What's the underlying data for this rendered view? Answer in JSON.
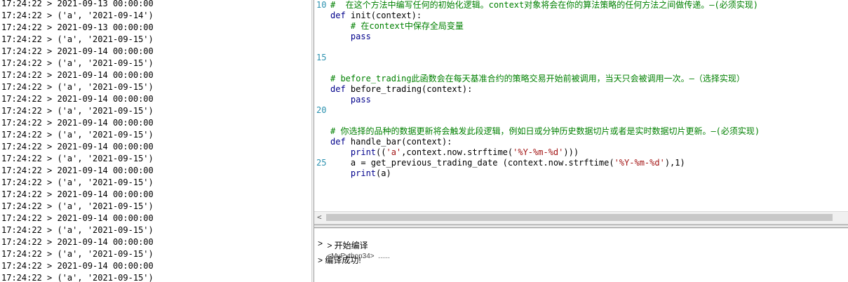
{
  "log": {
    "lines": [
      "17:24:22 > 2021-09-13 00:00:00",
      "17:24:22 > ('a', '2021-09-14')",
      "17:24:22 > 2021-09-13 00:00:00",
      "17:24:22 > ('a', '2021-09-15')",
      "17:24:22 > 2021-09-14 00:00:00",
      "17:24:22 > ('a', '2021-09-15')",
      "17:24:22 > 2021-09-14 00:00:00",
      "17:24:22 > ('a', '2021-09-15')",
      "17:24:22 > 2021-09-14 00:00:00",
      "17:24:22 > ('a', '2021-09-15')",
      "17:24:22 > 2021-09-14 00:00:00",
      "17:24:22 > ('a', '2021-09-15')",
      "17:24:22 > 2021-09-14 00:00:00",
      "17:24:22 > ('a', '2021-09-15')",
      "17:24:22 > 2021-09-14 00:00:00",
      "17:24:22 > ('a', '2021-09-15')",
      "17:24:22 > 2021-09-14 00:00:00",
      "17:24:22 > ('a', '2021-09-15')",
      "17:24:22 > 2021-09-14 00:00:00",
      "17:24:22 > ('a', '2021-09-15')",
      "17:24:22 > 2021-09-14 00:00:00",
      "17:24:22 > ('a', '2021-09-15')",
      "17:24:22 > 2021-09-14 00:00:00",
      "17:24:22 > ('a', '2021-09-15')"
    ]
  },
  "editor": {
    "line_numbers": [
      "10",
      "15",
      "20",
      "25"
    ],
    "code": [
      "#  在这个方法中编写任何的初始化逻辑。context对象将会在你的算法策略的任何方法之间做传递。—(必须实现)",
      "def init(context):",
      "    # 在context中保存全局变量",
      "    pass",
      "",
      "",
      "",
      "# before_trading此函数会在每天基准合约的策略交易开始前被调用，当天只会被调用一次。—（选择实现）",
      "def before_trading(context):",
      "    pass",
      "",
      "",
      "# 你选择的品种的数据更新将会触发此段逻辑，例如日或分钟历史数据切片或者是实时数据切片更新。—(必须实现)",
      "def handle_bar(context):",
      "    print(('a',context.now.strftime('%Y-%m-%d')))",
      "    a = get_previous_trading_date (context.now.strftime('%Y-%m-%d'),1)",
      "    print(a)"
    ]
  },
  "output": {
    "compile_start": "> 开始编译",
    "compile_target": "<MyPython34>  ......",
    "prompt": ">",
    "compile_success": "> 编译成功!"
  },
  "scroll": {
    "left_arrow": "<"
  }
}
